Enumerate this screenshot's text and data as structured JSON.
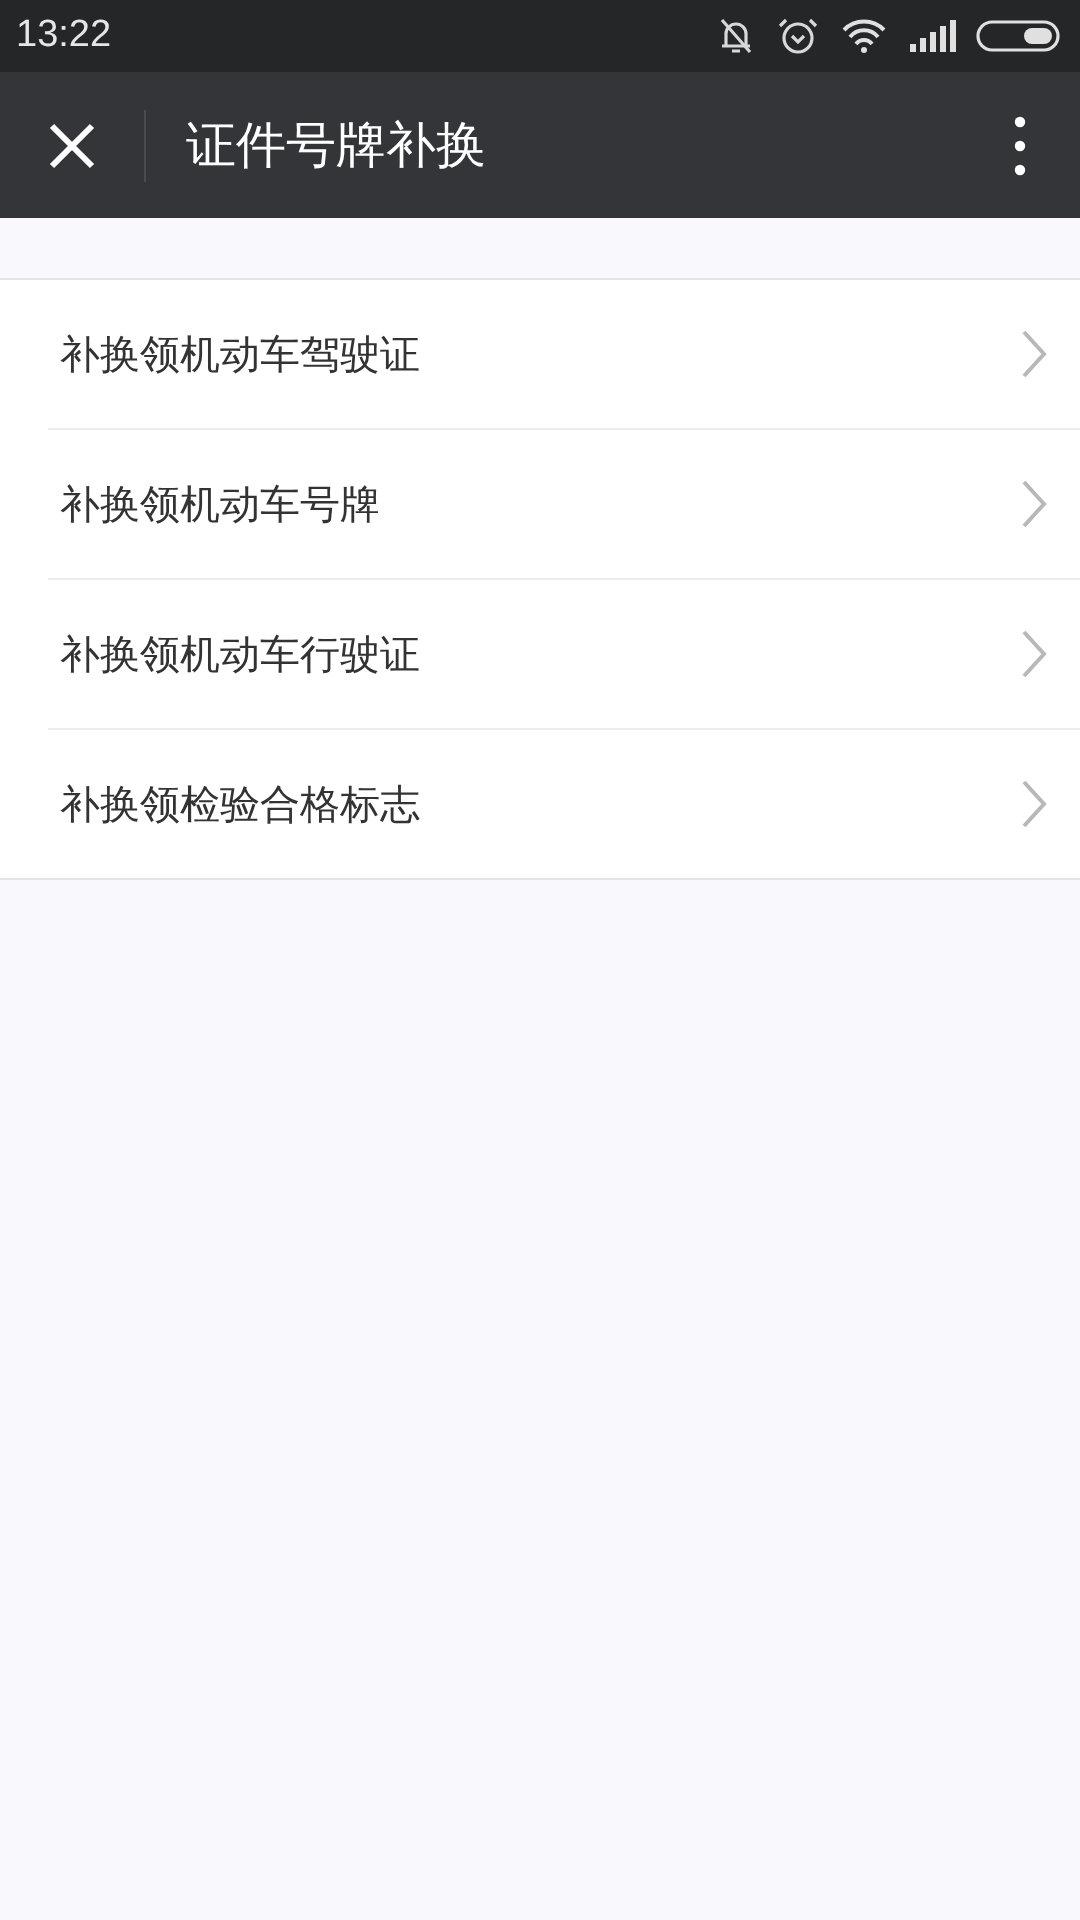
{
  "status_bar": {
    "time": "13:22"
  },
  "header": {
    "title": "证件号牌补换"
  },
  "menu_items": [
    {
      "label": "补换领机动车驾驶证"
    },
    {
      "label": "补换领机动车号牌"
    },
    {
      "label": "补换领机动车行驶证"
    },
    {
      "label": "补换领检验合格标志"
    }
  ]
}
